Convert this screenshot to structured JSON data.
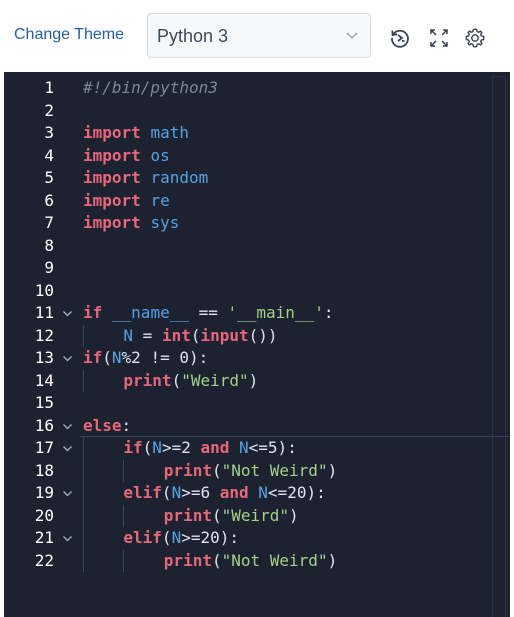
{
  "toolbar": {
    "change_theme": "Change Theme",
    "language": "Python 3",
    "icons": [
      "restore-icon",
      "fullscreen-icon",
      "settings-icon"
    ]
  },
  "editor": {
    "colors": {
      "background": "#1c2230",
      "keyword": "#e8677a",
      "name": "#53a3e6",
      "string": "#a6d189",
      "comment": "#7c8798"
    },
    "lines": [
      {
        "n": "1",
        "fold": false,
        "indent": 0,
        "tokens": [
          {
            "t": "#!/bin/python3",
            "c": "cm"
          }
        ]
      },
      {
        "n": "2",
        "fold": false,
        "indent": 0,
        "tokens": []
      },
      {
        "n": "3",
        "fold": false,
        "indent": 0,
        "tokens": [
          {
            "t": "import",
            "c": "kw"
          },
          {
            "t": " ",
            "c": "pl"
          },
          {
            "t": "math",
            "c": "nm"
          }
        ]
      },
      {
        "n": "4",
        "fold": false,
        "indent": 0,
        "tokens": [
          {
            "t": "import",
            "c": "kw"
          },
          {
            "t": " ",
            "c": "pl"
          },
          {
            "t": "os",
            "c": "nm"
          }
        ]
      },
      {
        "n": "5",
        "fold": false,
        "indent": 0,
        "tokens": [
          {
            "t": "import",
            "c": "kw"
          },
          {
            "t": " ",
            "c": "pl"
          },
          {
            "t": "random",
            "c": "nm"
          }
        ]
      },
      {
        "n": "6",
        "fold": false,
        "indent": 0,
        "tokens": [
          {
            "t": "import",
            "c": "kw"
          },
          {
            "t": " ",
            "c": "pl"
          },
          {
            "t": "re",
            "c": "nm"
          }
        ]
      },
      {
        "n": "7",
        "fold": false,
        "indent": 0,
        "tokens": [
          {
            "t": "import",
            "c": "kw"
          },
          {
            "t": " ",
            "c": "pl"
          },
          {
            "t": "sys",
            "c": "nm"
          }
        ]
      },
      {
        "n": "8",
        "fold": false,
        "indent": 0,
        "tokens": []
      },
      {
        "n": "9",
        "fold": false,
        "indent": 0,
        "tokens": []
      },
      {
        "n": "10",
        "fold": false,
        "indent": 0,
        "tokens": []
      },
      {
        "n": "11",
        "fold": true,
        "indent": 0,
        "tokens": [
          {
            "t": "if",
            "c": "kw"
          },
          {
            "t": " ",
            "c": "pl"
          },
          {
            "t": "__name__",
            "c": "nm"
          },
          {
            "t": " == ",
            "c": "pl"
          },
          {
            "t": "'__main__'",
            "c": "st"
          },
          {
            "t": ":",
            "c": "pl"
          }
        ]
      },
      {
        "n": "12",
        "fold": false,
        "indent": 1,
        "tokens": [
          {
            "t": "N",
            "c": "nm"
          },
          {
            "t": " = ",
            "c": "pl"
          },
          {
            "t": "int",
            "c": "fn"
          },
          {
            "t": "(",
            "c": "pl"
          },
          {
            "t": "input",
            "c": "fn"
          },
          {
            "t": "())",
            "c": "pl"
          }
        ]
      },
      {
        "n": "13",
        "fold": true,
        "indent": 0,
        "tokens": [
          {
            "t": "if",
            "c": "kw"
          },
          {
            "t": "(",
            "c": "pl"
          },
          {
            "t": "N",
            "c": "nm"
          },
          {
            "t": "%2 != 0):",
            "c": "pl"
          }
        ]
      },
      {
        "n": "14",
        "fold": false,
        "indent": 1,
        "tokens": [
          {
            "t": "print",
            "c": "fn"
          },
          {
            "t": "(",
            "c": "pl"
          },
          {
            "t": "\"Weird\"",
            "c": "st"
          },
          {
            "t": ")",
            "c": "pl"
          }
        ]
      },
      {
        "n": "15",
        "fold": false,
        "indent": 0,
        "tokens": []
      },
      {
        "n": "16",
        "fold": true,
        "indent": 0,
        "tokens": [
          {
            "t": "else",
            "c": "kw"
          },
          {
            "t": ":",
            "c": "pl"
          }
        ]
      },
      {
        "n": "17",
        "fold": true,
        "indent": 1,
        "tokens": [
          {
            "t": "if",
            "c": "kw"
          },
          {
            "t": "(",
            "c": "pl"
          },
          {
            "t": "N",
            "c": "nm"
          },
          {
            "t": ">=2 ",
            "c": "pl"
          },
          {
            "t": "and",
            "c": "kw"
          },
          {
            "t": " ",
            "c": "pl"
          },
          {
            "t": "N",
            "c": "nm"
          },
          {
            "t": "<=5):",
            "c": "pl"
          }
        ]
      },
      {
        "n": "18",
        "fold": false,
        "indent": 2,
        "tokens": [
          {
            "t": "print",
            "c": "fn"
          },
          {
            "t": "(",
            "c": "pl"
          },
          {
            "t": "\"Not Weird\"",
            "c": "st"
          },
          {
            "t": ")",
            "c": "pl"
          }
        ]
      },
      {
        "n": "19",
        "fold": true,
        "indent": 1,
        "tokens": [
          {
            "t": "elif",
            "c": "kw"
          },
          {
            "t": "(",
            "c": "pl"
          },
          {
            "t": "N",
            "c": "nm"
          },
          {
            "t": ">=6 ",
            "c": "pl"
          },
          {
            "t": "and",
            "c": "kw"
          },
          {
            "t": " ",
            "c": "pl"
          },
          {
            "t": "N",
            "c": "nm"
          },
          {
            "t": "<=20):",
            "c": "pl"
          }
        ]
      },
      {
        "n": "20",
        "fold": false,
        "indent": 2,
        "tokens": [
          {
            "t": "print",
            "c": "fn"
          },
          {
            "t": "(",
            "c": "pl"
          },
          {
            "t": "\"Weird\"",
            "c": "st"
          },
          {
            "t": ")",
            "c": "pl"
          }
        ]
      },
      {
        "n": "21",
        "fold": true,
        "indent": 1,
        "tokens": [
          {
            "t": "elif",
            "c": "kw"
          },
          {
            "t": "(",
            "c": "pl"
          },
          {
            "t": "N",
            "c": "nm"
          },
          {
            "t": ">=20):",
            "c": "pl"
          }
        ]
      },
      {
        "n": "22",
        "fold": false,
        "indent": 2,
        "tokens": [
          {
            "t": "print",
            "c": "fn"
          },
          {
            "t": "(",
            "c": "pl"
          },
          {
            "t": "\"Not Weird\"",
            "c": "st"
          },
          {
            "t": ")",
            "c": "pl"
          }
        ]
      }
    ]
  }
}
